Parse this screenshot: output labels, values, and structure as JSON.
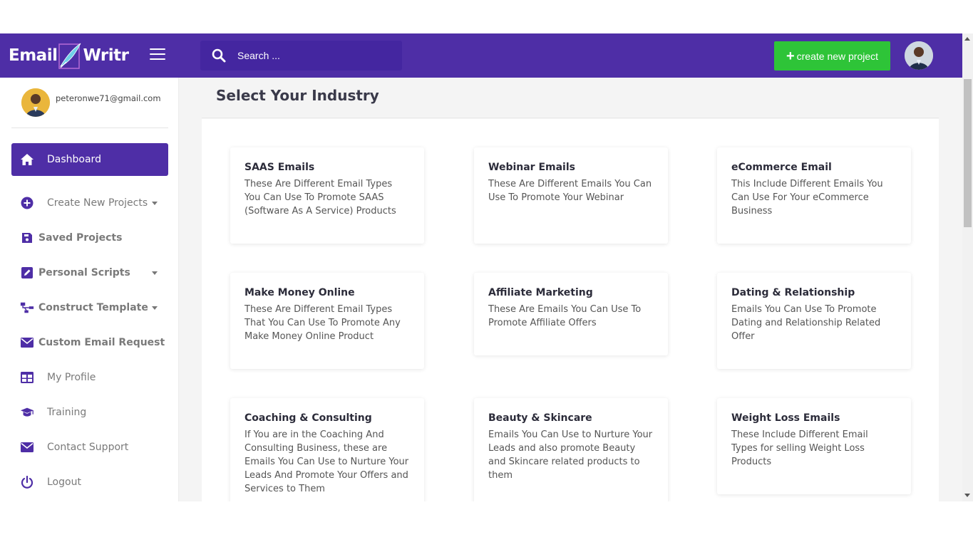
{
  "brand": {
    "word1": "Email",
    "word2": "Writr"
  },
  "search": {
    "placeholder": "Search ..."
  },
  "header": {
    "create_label": "create new project",
    "create_icon": "plus-icon"
  },
  "user": {
    "email": "peteronwe71@gmail.com"
  },
  "sidebar": {
    "items": [
      {
        "label": "Dashboard",
        "icon": "home-icon"
      },
      {
        "label": "Create New Projects",
        "icon": "plus-circle-icon"
      },
      {
        "label": "Saved Projects",
        "icon": "save-icon"
      },
      {
        "label": "Personal Scripts",
        "icon": "edit-icon"
      },
      {
        "label": "Construct Template",
        "icon": "sitemap-icon"
      },
      {
        "label": "Custom Email Request",
        "icon": "envelope-icon"
      },
      {
        "label": "My Profile",
        "icon": "table-icon"
      },
      {
        "label": "Training",
        "icon": "graduation-cap-icon"
      },
      {
        "label": "Contact Support",
        "icon": "envelope-icon"
      },
      {
        "label": "Logout",
        "icon": "power-icon"
      }
    ]
  },
  "main": {
    "title": "Select Your Industry",
    "cards": [
      {
        "title": "SAAS Emails",
        "desc": "These Are Different Email Types You Can Use To Promote SAAS (Software As A Service) Products"
      },
      {
        "title": "Webinar Emails",
        "desc": "These Are Different Emails You Can Use To Promote Your Webinar"
      },
      {
        "title": "eCommerce Email",
        "desc": "This Include Different Emails You Can Use For Your eCommerce Business"
      },
      {
        "title": "Make Money Online",
        "desc": "These Are Different Email Types That You Can Use To Promote Any Make Money Online Product"
      },
      {
        "title": "Affiliate Marketing",
        "desc": "These Are Emails You Can Use To Promote Affiliate Offers"
      },
      {
        "title": "Dating & Relationship",
        "desc": "Emails You Can Use To Promote Dating and Relationship Related Offer"
      },
      {
        "title": "Coaching & Consulting",
        "desc": "If You are in the Coaching And Consulting Business, these are Emails You Can Use to Nurture Your Leads And Promote Your Offers and Services to Them"
      },
      {
        "title": "Beauty & Skincare",
        "desc": "Emails You Can Use to Nurture Your Leads and also promote Beauty and Skincare related products to them"
      },
      {
        "title": "Weight Loss Emails",
        "desc": "These Include Different Email Types for selling Weight Loss Products"
      }
    ]
  },
  "colors": {
    "brand_purple": "#4e2ea6",
    "create_green": "#2ec438"
  }
}
